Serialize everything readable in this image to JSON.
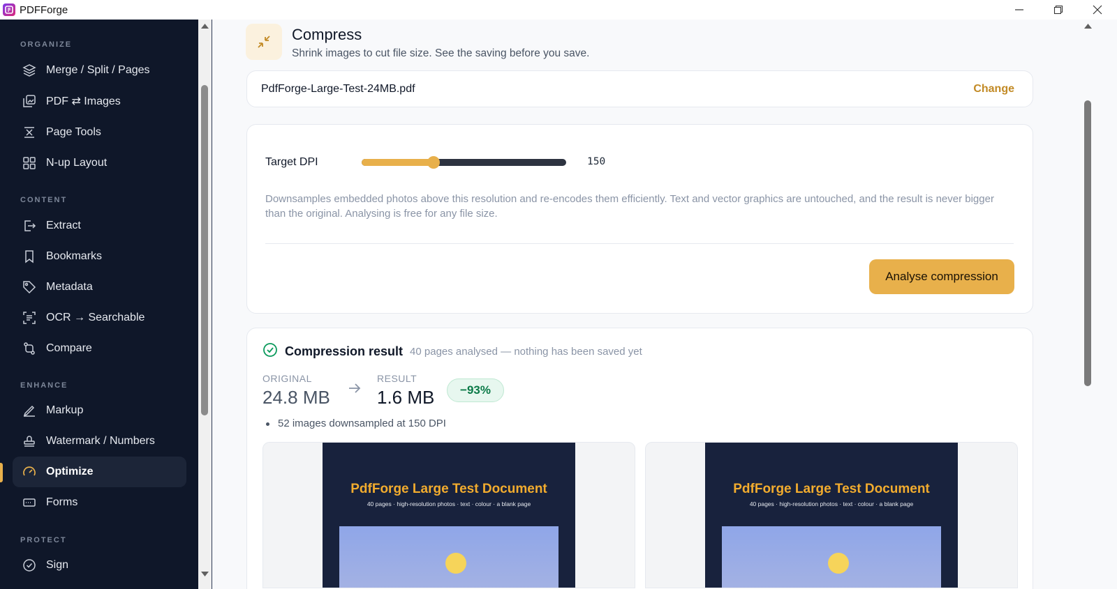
{
  "window": {
    "title": "PDFForge"
  },
  "sidebar": {
    "sections": [
      {
        "label": "ORGANIZE",
        "items": [
          {
            "label": "Merge / Split / Pages",
            "icon": "layers-icon"
          },
          {
            "label": "PDF ⇄ Images",
            "icon": "images-icon"
          },
          {
            "label": "Page Tools",
            "icon": "page-tools-icon"
          },
          {
            "label": "N-up Layout",
            "icon": "grid-icon"
          }
        ]
      },
      {
        "label": "CONTENT",
        "items": [
          {
            "label": "Extract",
            "icon": "extract-icon"
          },
          {
            "label": "Bookmarks",
            "icon": "bookmark-icon"
          },
          {
            "label": "Metadata",
            "icon": "tag-icon"
          },
          {
            "label": "OCR → Searchable",
            "icon": "scan-text-icon"
          },
          {
            "label": "Compare",
            "icon": "compare-icon"
          }
        ]
      },
      {
        "label": "ENHANCE",
        "items": [
          {
            "label": "Markup",
            "icon": "pen-icon"
          },
          {
            "label": "Watermark / Numbers",
            "icon": "stamp-icon"
          },
          {
            "label": "Optimize",
            "icon": "gauge-icon",
            "active": true
          },
          {
            "label": "Forms",
            "icon": "form-icon"
          }
        ]
      },
      {
        "label": "PROTECT",
        "items": [
          {
            "label": "Sign",
            "icon": "check-badge-icon"
          }
        ]
      }
    ]
  },
  "page": {
    "icon": "compress-icon",
    "title": "Compress",
    "subtitle": "Shrink images to cut file size. See the saving before you save."
  },
  "file": {
    "name": "PdfForge-Large-Test-24MB.pdf",
    "change_label": "Change"
  },
  "settings": {
    "dpi_label": "Target DPI",
    "dpi_value": "150",
    "dpi_fraction": 0.35,
    "description": "Downsamples embedded photos above this resolution and re-encodes them efficiently. Text and vector graphics are untouched, and the result is never bigger than the original. Analysing is free for any file size.",
    "analyse_label": "Analyse compression"
  },
  "result": {
    "title": "Compression result",
    "meta": "40 pages analysed — nothing has been saved yet",
    "original_label": "ORIGINAL",
    "original_value": "24.8 MB",
    "result_label": "RESULT",
    "result_value": "1.6 MB",
    "saving": "−93%",
    "detail": "52 images downsampled at 150 DPI",
    "preview_title": "PdfForge Large Test Document",
    "preview_sub": "40 pages · high-resolution photos · text · colour · a blank page"
  },
  "colors": {
    "accent": "#e8b04b",
    "sidebar_bg": "#0f1729",
    "success": "#0b7a48"
  }
}
